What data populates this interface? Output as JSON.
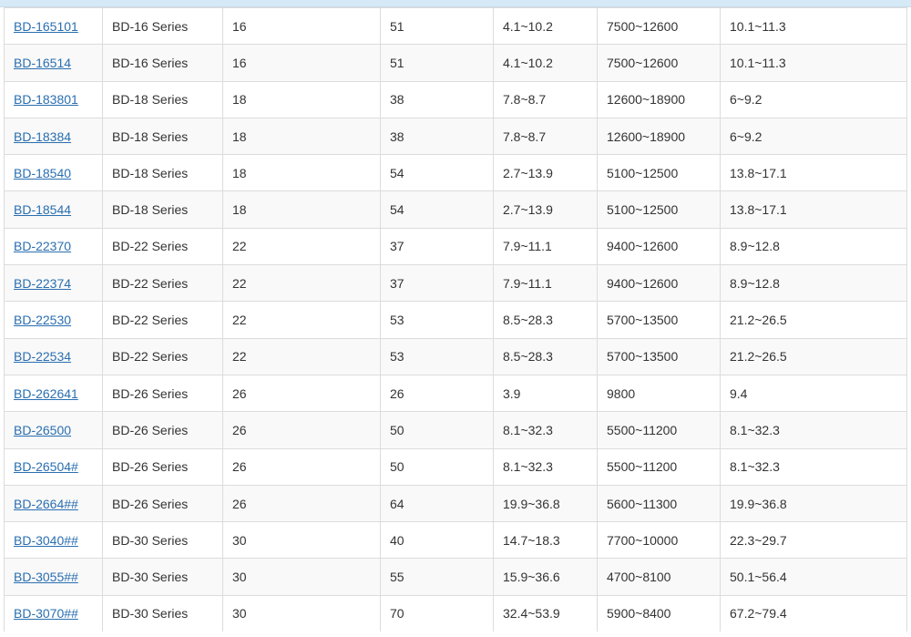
{
  "table": {
    "rows": [
      {
        "model": "BD-165101",
        "series": "BD-16 Series",
        "c3": "16",
        "c4": "51",
        "c5": "4.1~10.2",
        "c6": "7500~12600",
        "c7": "10.1~11.3"
      },
      {
        "model": "BD-16514",
        "series": "BD-16 Series",
        "c3": "16",
        "c4": "51",
        "c5": "4.1~10.2",
        "c6": "7500~12600",
        "c7": "10.1~11.3"
      },
      {
        "model": "BD-183801",
        "series": "BD-18 Series",
        "c3": "18",
        "c4": "38",
        "c5": "7.8~8.7",
        "c6": "12600~18900",
        "c7": "6~9.2"
      },
      {
        "model": "BD-18384",
        "series": "BD-18 Series",
        "c3": "18",
        "c4": "38",
        "c5": "7.8~8.7",
        "c6": "12600~18900",
        "c7": "6~9.2"
      },
      {
        "model": "BD-18540",
        "series": "BD-18 Series",
        "c3": "18",
        "c4": "54",
        "c5": "2.7~13.9",
        "c6": "5100~12500",
        "c7": "13.8~17.1"
      },
      {
        "model": "BD-18544",
        "series": "BD-18 Series",
        "c3": "18",
        "c4": "54",
        "c5": "2.7~13.9",
        "c6": "5100~12500",
        "c7": "13.8~17.1"
      },
      {
        "model": "BD-22370",
        "series": "BD-22 Series",
        "c3": "22",
        "c4": "37",
        "c5": "7.9~11.1",
        "c6": "9400~12600",
        "c7": "8.9~12.8"
      },
      {
        "model": "BD-22374",
        "series": "BD-22 Series",
        "c3": "22",
        "c4": "37",
        "c5": "7.9~11.1",
        "c6": "9400~12600",
        "c7": "8.9~12.8"
      },
      {
        "model": "BD-22530",
        "series": "BD-22 Series",
        "c3": "22",
        "c4": "53",
        "c5": "8.5~28.3",
        "c6": "5700~13500",
        "c7": "21.2~26.5"
      },
      {
        "model": "BD-22534",
        "series": "BD-22 Series",
        "c3": "22",
        "c4": "53",
        "c5": "8.5~28.3",
        "c6": "5700~13500",
        "c7": "21.2~26.5"
      },
      {
        "model": "BD-262641",
        "series": "BD-26 Series",
        "c3": "26",
        "c4": "26",
        "c5": "3.9",
        "c6": "9800",
        "c7": "9.4"
      },
      {
        "model": "BD-26500",
        "series": "BD-26 Series",
        "c3": "26",
        "c4": "50",
        "c5": "8.1~32.3",
        "c6": "5500~11200",
        "c7": "8.1~32.3"
      },
      {
        "model": "BD-26504#",
        "series": "BD-26 Series",
        "c3": "26",
        "c4": "50",
        "c5": "8.1~32.3",
        "c6": "5500~11200",
        "c7": "8.1~32.3"
      },
      {
        "model": "BD-2664##",
        "series": "BD-26 Series",
        "c3": "26",
        "c4": "64",
        "c5": "19.9~36.8",
        "c6": "5600~11300",
        "c7": "19.9~36.8"
      },
      {
        "model": "BD-3040##",
        "series": "BD-30 Series",
        "c3": "30",
        "c4": "40",
        "c5": "14.7~18.3",
        "c6": "7700~10000",
        "c7": "22.3~29.7"
      },
      {
        "model": "BD-3055##",
        "series": "BD-30 Series",
        "c3": "30",
        "c4": "55",
        "c5": "15.9~36.6",
        "c6": "4700~8100",
        "c7": "50.1~56.4"
      },
      {
        "model": "BD-3070##",
        "series": "BD-30 Series",
        "c3": "30",
        "c4": "70",
        "c5": "32.4~53.9",
        "c6": "5900~8400",
        "c7": "67.2~79.4"
      }
    ]
  },
  "colors": {
    "link": "#2a6fb0",
    "text": "#333333",
    "border": "#dcdcdc",
    "header_strip": "#d6e9f7"
  }
}
